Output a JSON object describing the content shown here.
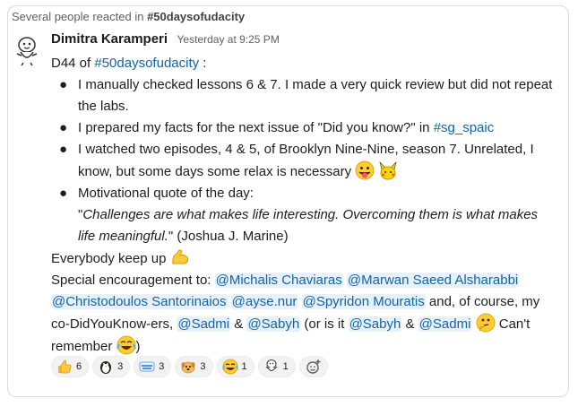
{
  "context": {
    "prefix": "Several people reacted in",
    "channel": "#50daysofudacity"
  },
  "message": {
    "author": "Dimitra Karamperi",
    "timestamp": "Yesterday at 9:25 PM",
    "intro": {
      "pre": "D44 of ",
      "channel": "#50daysofudacity",
      "post": " :"
    },
    "bullets": [
      {
        "text": "I manually checked lessons 6 & 7. I made a very quick review but did not repeat the labs."
      },
      {
        "pre": "I prepared my facts for the next issue of \"Did you know?\" in ",
        "channel": "#sg_spaic"
      },
      {
        "text": "I watched two episodes, 4 & 5, of Brooklyn Nine-Nine, season 7. Unrelated, I know, but some days some relax is necessary"
      },
      {
        "line1": "Motivational quote of the day:",
        "quote": "Challenges are what makes life interesting. Overcoming them is what makes life meaningful.",
        "attribution": " (Joshua J. Marine)"
      }
    ],
    "keep_up": "Everybody keep up",
    "special": "Special encouragement to:",
    "mentions": [
      "@Michalis Chaviaras",
      "@Marwan Saeed Alsharabbi",
      "@Christodoulos Santorinaios",
      "@ayse.nur",
      "@Spyridon Mouratis"
    ],
    "and_text": " and, of course, my co-DidYouKnow-ers, ",
    "sadmi": "@Sadmi",
    "amp": " & ",
    "sabyh": "@Sabyh",
    "or_text": " (or is it ",
    "cant": " Can't remember ",
    "close": ")"
  },
  "reactions": [
    {
      "icon": "thumbs-up-icon",
      "count": "6"
    },
    {
      "icon": "penguin-icon",
      "count": "3"
    },
    {
      "icon": "thank-you-icon",
      "count": "3"
    },
    {
      "icon": "dog-icon",
      "count": "3"
    },
    {
      "icon": "joy-icon",
      "count": "1"
    },
    {
      "icon": "waving-figure-icon",
      "count": "1"
    }
  ],
  "add_reaction_icon": "add-reaction-icon"
}
